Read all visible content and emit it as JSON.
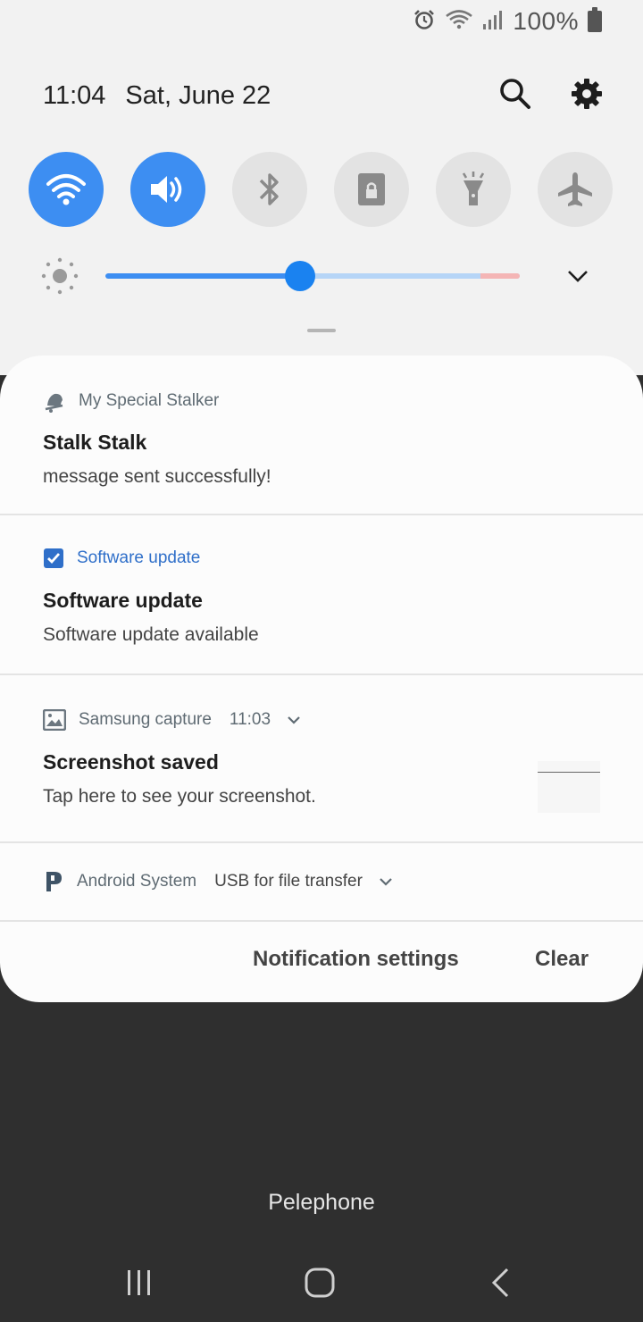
{
  "status_bar": {
    "battery_text": "100%",
    "icons": [
      "alarm-icon",
      "wifi-icon",
      "signal-icon",
      "battery-icon"
    ]
  },
  "header": {
    "time": "11:04",
    "date": "Sat, June 22",
    "actions": [
      "search-icon",
      "gear-icon"
    ]
  },
  "quick_toggles": [
    {
      "name": "wifi",
      "icon": "wifi-icon",
      "active": true
    },
    {
      "name": "sound",
      "icon": "speaker-icon",
      "active": true
    },
    {
      "name": "bluetooth",
      "icon": "bluetooth-icon",
      "active": false
    },
    {
      "name": "rotation-lock",
      "icon": "lock-icon",
      "active": false
    },
    {
      "name": "flashlight",
      "icon": "flashlight-icon",
      "active": false
    },
    {
      "name": "airplane-mode",
      "icon": "airplane-icon",
      "active": false
    }
  ],
  "brightness": {
    "level": 0.47
  },
  "colors": {
    "accent": "#3d8ef2",
    "shade_bg": "#f2f2f2",
    "card_bg": "#fcfcfc",
    "nav_bg": "#2f2f2f"
  },
  "notifications": [
    {
      "app": "My Special Stalker",
      "icon": "bell-icon",
      "title": "Stalk Stalk",
      "text": "message sent successfully!"
    },
    {
      "app": "Software update",
      "icon": "checkbox-icon",
      "title": "Software update",
      "text": "Software update available"
    },
    {
      "app": "Samsung capture",
      "icon": "image-icon",
      "time": "11:03",
      "title": "Screenshot saved",
      "text": "Tap here to see your screenshot."
    },
    {
      "app": "Android System",
      "icon": "android-p-icon",
      "subtitle": "USB for file transfer"
    }
  ],
  "actions": {
    "settings": "Notification settings",
    "clear": "Clear"
  },
  "carrier": "Pelephone",
  "nav": [
    "recents-icon",
    "home-icon",
    "back-icon"
  ]
}
